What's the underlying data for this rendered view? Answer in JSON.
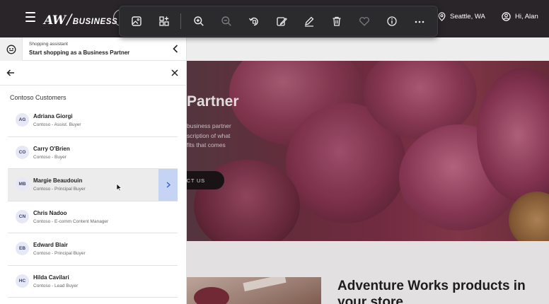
{
  "header": {
    "logo_brand": "AW",
    "logo_product": "BUSINESS",
    "location": "Seattle, WA",
    "greeting": "Hi, Alan"
  },
  "viewer_toolbar": {
    "buttons": [
      "image-icon",
      "apps-icon",
      "zoom-in-icon",
      "zoom-out-icon",
      "rotate-icon",
      "edit-image-icon",
      "draw-icon",
      "delete-icon",
      "favorite-icon",
      "info-icon",
      "more-icon"
    ]
  },
  "hero": {
    "title": "Partner",
    "text_line1": "business partner",
    "text_line2": "scription of what",
    "text_line3": "fits that comes",
    "cta": "CT US"
  },
  "promo": {
    "title": "Adventure Works products in your store"
  },
  "panel": {
    "assistant_label": "Shopping assistant",
    "assistant_title": "Start shopping as a Business Partner",
    "section_title": "Contoso Customers",
    "customers": [
      {
        "initials": "AG",
        "name": "Adriana Giorgi",
        "role": "Contoso - Assist. Buyer"
      },
      {
        "initials": "CO",
        "name": "Carry O'Brien",
        "role": "Contoso - Buyer"
      },
      {
        "initials": "MB",
        "name": "Margie Beaudouin",
        "role": "Contoso - Principal Buyer"
      },
      {
        "initials": "CN",
        "name": "Chris Nadoo",
        "role": "Contoso - E-comm Content Manager"
      },
      {
        "initials": "EB",
        "name": "Edward Blair",
        "role": "Contoso - Principal Buyer"
      },
      {
        "initials": "HC",
        "name": "Hilda Cavilari",
        "role": "Contoso - Lead Buyer"
      }
    ],
    "active_customer": "Margie Beaudouin"
  },
  "colors": {
    "topbar": "#2a2529",
    "active_arrow_bg": "#c5d3f5",
    "avatar_bg": "#e6e9f5"
  }
}
